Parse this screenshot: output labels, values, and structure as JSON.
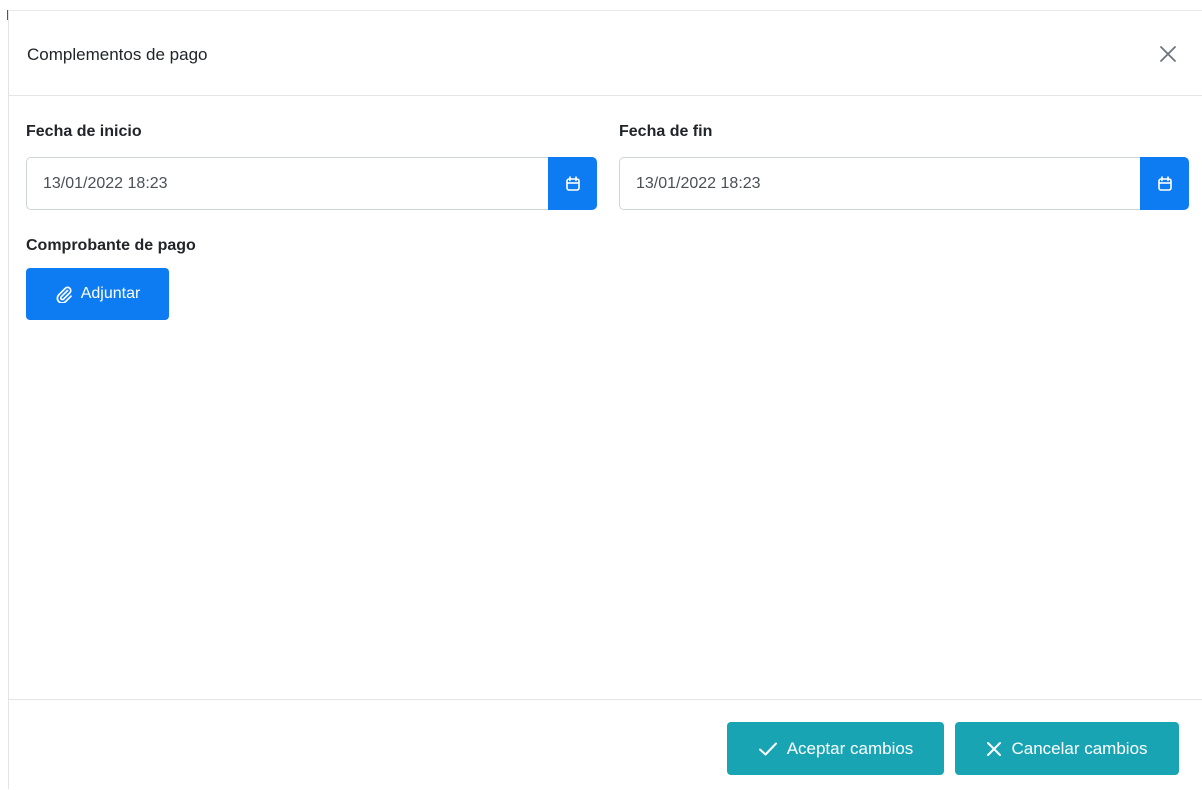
{
  "modal": {
    "title": "Complementos de pago"
  },
  "form": {
    "start_date": {
      "label": "Fecha de inicio",
      "value": "13/01/2022 18:23"
    },
    "end_date": {
      "label": "Fecha de fin",
      "value": "13/01/2022 18:23"
    },
    "receipt": {
      "label": "Comprobante de pago",
      "attach_label": "Adjuntar"
    }
  },
  "footer": {
    "accept_label": "Aceptar cambios",
    "cancel_label": "Cancelar cambios"
  },
  "icons": {
    "close": "close-icon",
    "calendar": "calendar-icon",
    "attach": "paperclip-icon",
    "check": "check-icon",
    "cancel": "x-icon"
  },
  "colors": {
    "primary": "#0d7cf2",
    "teal": "#19a4b4"
  }
}
